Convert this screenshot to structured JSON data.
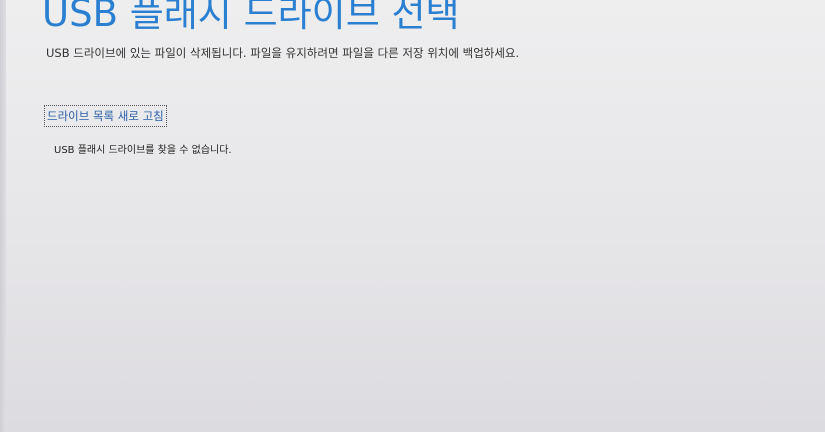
{
  "page": {
    "title": "USB 플래시 드라이브 선택",
    "description": "USB 드라이브에 있는 파일이 삭제됩니다. 파일을 유지하려면 파일을 다른 저장 위치에 백업하세요.",
    "refresh_label": "드라이브 목록 새로 고침",
    "status_message": "USB 플래시 드라이브를 찾을 수 없습니다."
  },
  "colors": {
    "accent": "#2a7fd1",
    "link": "#2a5fa8",
    "text": "#333333"
  }
}
